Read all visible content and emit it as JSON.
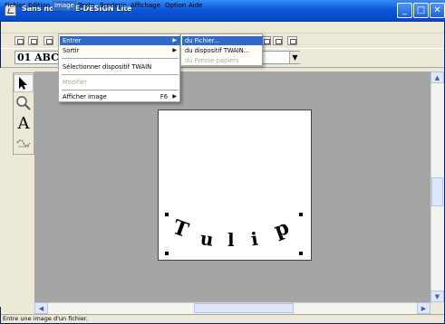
{
  "window": {
    "title": "Sans nom - PE-DESIGN Lite",
    "controls": {
      "minimize": "_",
      "maximize": "□",
      "close": "✕"
    }
  },
  "menubar": {
    "items": [
      {
        "label": "Fichier"
      },
      {
        "label": "Edition"
      },
      {
        "label": "Image"
      },
      {
        "label": "Texte"
      },
      {
        "label": "Broderie"
      },
      {
        "label": "Affichage"
      },
      {
        "label": "Option"
      },
      {
        "label": "Aide"
      }
    ],
    "active": "Image"
  },
  "toolbar": {
    "font_box_text": "01 ABC"
  },
  "image_menu": {
    "items": [
      {
        "label": "Entrer",
        "submenu": true
      },
      {
        "label": "Sortir",
        "submenu": true
      },
      {
        "label": "Sélectionner dispositif TWAIN"
      },
      {
        "label": "Modifier",
        "disabled": true
      },
      {
        "label": "Afficher image",
        "shortcut": "F6",
        "submenu": true
      }
    ]
  },
  "entrer_submenu": {
    "items": [
      {
        "label": "du Fichier..."
      },
      {
        "label": "du dispositif TWAIN..."
      },
      {
        "label": "du Presse-papiers",
        "disabled": true
      }
    ]
  },
  "left_tools": {
    "items": [
      {
        "name": "select-arrow-icon",
        "label": ""
      },
      {
        "name": "zoom-icon",
        "label": ""
      },
      {
        "name": "text-tool",
        "label": "A"
      },
      {
        "name": "stitch-icon",
        "label": ""
      }
    ]
  },
  "canvas": {
    "letters": [
      "T",
      "u",
      "l",
      "i",
      "p"
    ]
  },
  "status": {
    "text": "Entre une image d'un fichier."
  },
  "colors": {
    "titlebar": "#0b58d8",
    "menu_highlight": "#316ac5",
    "workspace": "#a5a5a5"
  }
}
